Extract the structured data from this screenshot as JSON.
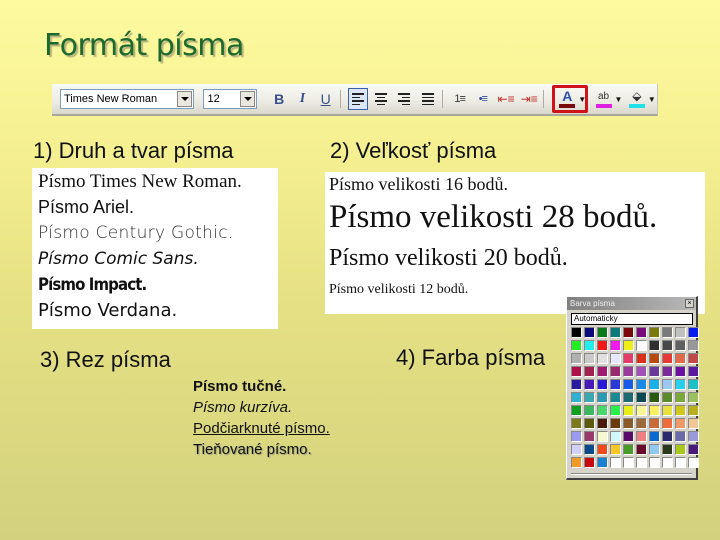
{
  "slide": {
    "title": "Formát písma"
  },
  "toolbar": {
    "font_value": "Times New Roman",
    "size_value": "12",
    "bold_label": "B",
    "italic_label": "I",
    "underline_label": "U",
    "numbered_list_glyph": "1≡",
    "bulleted_list_glyph": "•≡",
    "decrease_indent_glyph": "⇤≡",
    "increase_indent_glyph": "⇥≡",
    "font_color_letter": "A",
    "highlight_letter": "ab",
    "fill_glyph": "⬙",
    "dropdown_glyph": "▼",
    "font_color_bar": "#7a0a0a",
    "highlight_bar": "#e020e0",
    "fill_bar": "#22e0e8",
    "highlight_accent": "#d0121a"
  },
  "sections": {
    "font_type": {
      "heading": "1) Druh a tvar písma",
      "samples": [
        "Písmo Times New Roman.",
        "Písmo Ariel.",
        "Písmo Century Gothic.",
        "Písmo Comic Sans.",
        "Písmo Impact.",
        "Písmo Verdana."
      ]
    },
    "font_size": {
      "heading": "2) Veľkosť písma",
      "samples": [
        "Písmo velikosti 16 bodů.",
        "Písmo velikosti 28 bodů.",
        "Písmo velikosti 20 bodů.",
        "Písmo velikosti 12 bodů."
      ]
    },
    "font_style": {
      "heading": "3) Rez písma",
      "samples": [
        "Písmo tučné.",
        "Písmo kurzíva.",
        "Podčiarknuté písmo.",
        "Tieňované písmo."
      ]
    },
    "font_color": {
      "heading": "4) Farba písma"
    }
  },
  "palette": {
    "title": "Barva písma",
    "close_glyph": "×",
    "automatic_label": "Automaticky",
    "colors": [
      "#000000",
      "#0a0a7a",
      "#0a7a1a",
      "#0a7a7a",
      "#7a0a0a",
      "#7a0a7a",
      "#7a7a0a",
      "#7a7a7a",
      "#c0c0c0",
      "#0a1aee",
      "#22ee22",
      "#22eeee",
      "#ee1a1a",
      "#ee1aee",
      "#eeee1a",
      "#ffffff",
      "#303030",
      "#484848",
      "#606060",
      "#989898",
      "#b0b0b0",
      "#cacaca",
      "#e0e0e0",
      "#e6e6ff",
      "#e83a6a",
      "#d8301a",
      "#b84a12",
      "#e83838",
      "#e06a4a",
      "#c04848",
      "#b0104a",
      "#a02050",
      "#a01a70",
      "#9a2a70",
      "#9a3a9a",
      "#a050b8",
      "#6a3a9a",
      "#7a2a9a",
      "#6a10a0",
      "#5a1aa0",
      "#2a1aa0",
      "#4a1ab8",
      "#2a1ad8",
      "#2a3ad8",
      "#1a5ae8",
      "#1a8ae8",
      "#1ab0e8",
      "#9ac8f0",
      "#2ad0f0",
      "#20c0c8",
      "#30b0d0",
      "#3aa8b0",
      "#2a9ab0",
      "#1a8a90",
      "#1a6a70",
      "#0a4a50",
      "#2a5a10",
      "#5a8a2a",
      "#7aa83a",
      "#9ac060",
      "#10a020",
      "#3ab860",
      "#4ad86a",
      "#2aee4a",
      "#e8f01a",
      "#f8f898",
      "#f8f060",
      "#e8e040",
      "#d0c818",
      "#b8b020",
      "#7a7a1a",
      "#5a5a0a",
      "#4a1a0a",
      "#6a3a0a",
      "#8a5a2a",
      "#9a6a3a",
      "#c86a3a",
      "#f06a3a",
      "#f09a6a",
      "#f0c898",
      "#9a9af0",
      "#9a3a6a",
      "#f8f8d0",
      "#d0f8f8",
      "#5a0a6a",
      "#f08080",
      "#0a6ad0",
      "#2a2a6a",
      "#6a6aaa",
      "#9a9ad8",
      "#d0d0f8",
      "#0a4a8a",
      "#f04a1a",
      "#f8c82a",
      "#4a9a2a",
      "#6a0a2a",
      "#90c8f0",
      "#2a3a1a",
      "#a8c81a",
      "#4a1a7a",
      "#f09a2a",
      "#c80a0a",
      "#1a80d0",
      "#ffffff",
      "#ffffff",
      "#ffffff",
      "#ffffff",
      "#ffffff",
      "#ffffff",
      "#ffffff"
    ]
  }
}
